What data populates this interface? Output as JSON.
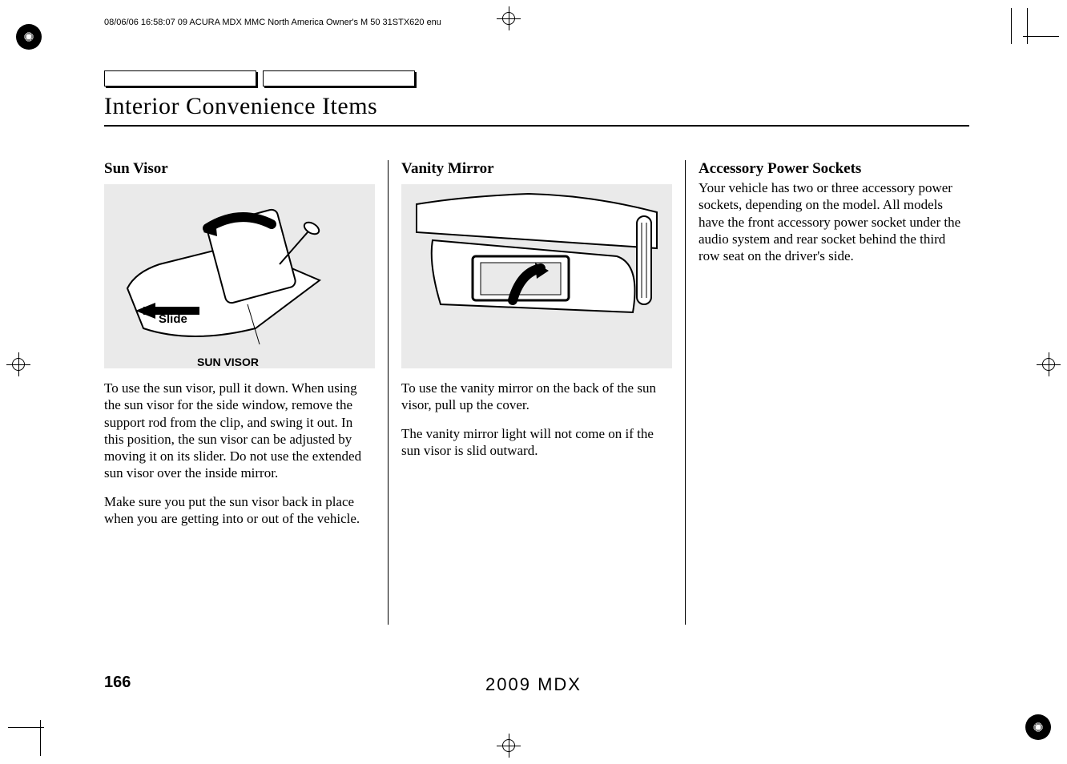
{
  "header_meta": "08/06/06 16:58:07   09 ACURA MDX MMC North America Owner's M 50 31STX620 enu",
  "page_title": "Interior Convenience Items",
  "columns": {
    "col1": {
      "heading": "Sun Visor",
      "illus_label_slide": "Slide",
      "illus_label_visor": "SUN VISOR",
      "para1": "To use the sun visor, pull it down. When using the sun visor for the side window, remove the support rod from the clip, and swing it out. In this position, the sun visor can be adjusted by moving it on its slider. Do not use the extended sun visor over the inside mirror.",
      "para2": "Make sure you put the sun visor back in place when you are getting into or out of the vehicle."
    },
    "col2": {
      "heading": "Vanity Mirror",
      "para1": "To use the vanity mirror on the back of the sun visor, pull up the cover.",
      "para2": "The vanity mirror light will not come on if the sun visor is slid outward."
    },
    "col3": {
      "heading": "Accessory Power Sockets",
      "para1": "Your vehicle has two or three accessory power sockets, depending on the model. All models have the front accessory power socket under the audio system and rear socket behind the third row seat on the driver's side."
    }
  },
  "page_number": "166",
  "footer_title": "2009  MDX"
}
